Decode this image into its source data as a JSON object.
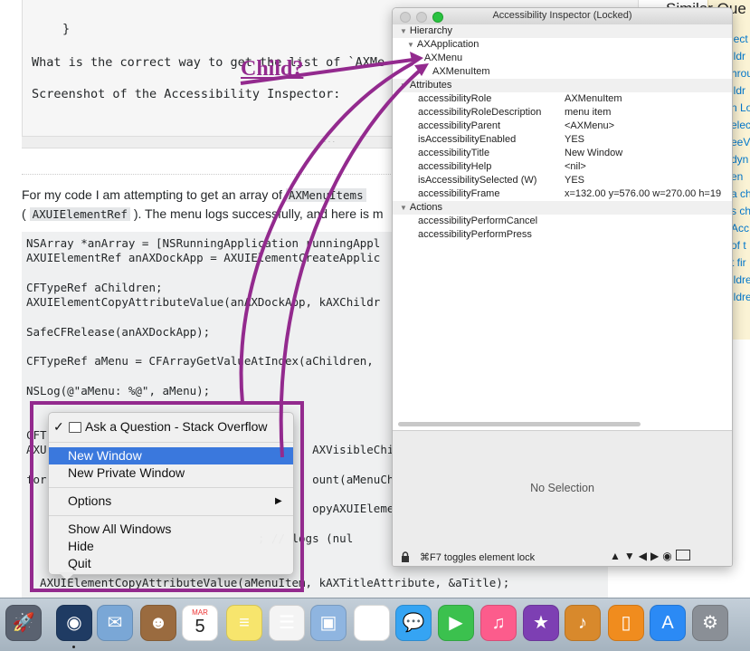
{
  "page": {
    "code_top_lines": [
      "}",
      "What is the correct way to get the list of `AXMe",
      "Screenshot of the Accessibility Inspector:"
    ],
    "prose_line1_pre": "For my code I am attempting to get an array of",
    "prose_line1_code": "AXMenuItems",
    "prose_line2_open": "(",
    "prose_line2_code": "AXUIElementRef",
    "prose_line2_post": "). The menu logs successfully, and here is m",
    "code_lines": [
      "NSArray *anArray = [NSRunningApplication runningAppl",
      "AXUIElementRef anAXDockApp = AXUIElementCreateApplic",
      "",
      "CFTypeRef aChildren;",
      "AXUIElementCopyAttributeValue(anAXDockApp, kAXChildr",
      "",
      "SafeCFRelease(anAXDockApp);",
      "",
      "CFTypeRef aMenu = CFArrayGetValueAtIndex(aChildren,",
      "",
      "NSLog(@\"aMenu: %@\", aMenu);",
      "",
      "",
      "CFT",
      "AXU                                       AXVisibleChild",
      "",
      "for                                       ount(aMenuChild",
      "",
      "                                          opyAXUIElement",
      "",
      "                                  ; // logs (nul",
      "",
      "",
      "  AXUIElementCopyAttributeValue(aMenuItem, kAXTitleAttribute, &aTitle);"
    ],
    "sidebar_title": "Similar Que",
    "sidebar_links": [
      "lect",
      "ildr",
      "hrou",
      "ildr",
      "n Lo",
      "elect",
      "eeV",
      "dyn",
      "en",
      "a ch",
      "s ch",
      "Acc",
      "of t",
      "t fir",
      "ildre",
      "ildre"
    ]
  },
  "annotation": {
    "child_label": "Child?"
  },
  "inspector": {
    "title": "Accessibility Inspector (Locked)",
    "hierarchy_label": "Hierarchy",
    "hierarchy": [
      "AXApplication",
      "AXMenu",
      "AXMenuItem"
    ],
    "attributes_label": "Attributes",
    "attributes": [
      {
        "key": "accessibilityRole",
        "value": "AXMenuItem"
      },
      {
        "key": "accessibilityRoleDescription",
        "value": "menu item"
      },
      {
        "key": "accessibilityParent",
        "value": "<AXMenu>"
      },
      {
        "key": "isAccessibilityEnabled",
        "value": "YES"
      },
      {
        "key": "accessibilityTitle",
        "value": "New Window"
      },
      {
        "key": "accessibilityHelp",
        "value": "<nil>"
      },
      {
        "key": "isAccessibilitySelected (W)",
        "value": "YES"
      },
      {
        "key": "accessibilityFrame",
        "value": "x=132.00 y=576.00 w=270.00 h=19"
      }
    ],
    "actions_label": "Actions",
    "actions": [
      "accessibilityPerformCancel",
      "accessibilityPerformPress"
    ],
    "no_selection": "No Selection",
    "lock_hint": "⌘F7 toggles element lock"
  },
  "context_menu": {
    "window_item": "Ask a Question - Stack Overflow",
    "items": [
      "New Window",
      "New Private Window",
      "Options",
      "Show All Windows",
      "Hide",
      "Quit"
    ],
    "highlighted": "New Window"
  },
  "dock_apps": [
    "Launchpad",
    "Safari",
    "Mail",
    "Contacts",
    "Calendar",
    "Notes",
    "Reminders",
    "Preview",
    "Photos",
    "Messages",
    "FaceTime",
    "iTunes",
    "iMovie",
    "GarageBand",
    "iBooks",
    "App Store",
    "System Preferences"
  ],
  "calendar": {
    "month": "MAR",
    "day": "5"
  },
  "colors": {
    "annotation": "#932a8e",
    "highlight": "#3a78dd",
    "sidebar": "#fbf3d5"
  }
}
